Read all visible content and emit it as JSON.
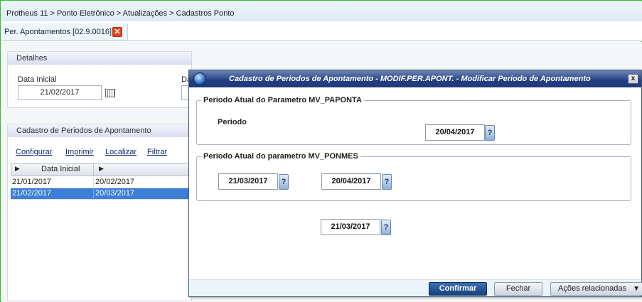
{
  "breadcrumb": "Protheus 11 > Ponto Eletrônico > Atualizações > Cadastros Ponto",
  "tab": {
    "label": "Per. Apontamentos [02.9.0016]",
    "close": "✕"
  },
  "details": {
    "header": "Detalhes",
    "start_label": "Data Inicial",
    "start_value": "21/02/2017",
    "cut_label": "Da"
  },
  "cadastro": {
    "header": "Cadastro de Periodos de Apontamento",
    "actions": [
      "Configurar",
      "Imprimir",
      "Localizar",
      "Filtrar"
    ],
    "columns": [
      "Data Inicial",
      ""
    ],
    "rows": [
      [
        "21/01/2017",
        "20/02/2017"
      ],
      [
        "21/02/2017",
        "20/03/2017"
      ]
    ]
  },
  "dialog": {
    "title": "Cadastro de Periodos de Apontamento - MODIF.PER.APONT. - Modificar Periodo de Apontamento",
    "close": "x",
    "group1": {
      "title": "Periodo Atual do Parametro MV_PAPONTA",
      "label": "Periodo",
      "value": "20/04/2017"
    },
    "group2": {
      "title": "Periodo Atual do parametro MV_PONMES",
      "value1": "21/03/2017",
      "value2": "20/04/2017"
    },
    "extra_value": "21/03/2017",
    "help": "?",
    "buttons": {
      "confirm": "Confirmar",
      "close": "Fechar",
      "actions": "Ações relacionadas",
      "actions_caret": "▼"
    }
  },
  "colors": {
    "selection": "#3b7fd6",
    "title_bar": "#233f82",
    "tab_close": "#e8431f",
    "frame": "#27c227"
  }
}
